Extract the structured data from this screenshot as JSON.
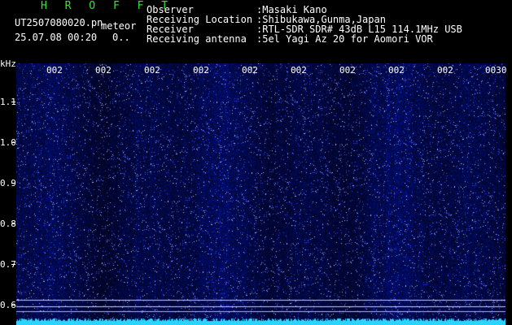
{
  "header": {
    "title": "H R O F F T",
    "file_name": "UT2507080020.pn",
    "file_tag": "meteor",
    "date_time": "25.07.08 00:20",
    "count": "0..",
    "rows": [
      {
        "label": "Observer",
        "value": ":Masaki Kano"
      },
      {
        "label": "Receiving Location",
        "value": ":Shibukawa,Gunma,Japan"
      },
      {
        "label": "Receiver",
        "value": ":RTL-SDR SDR# 43dB L15 114.1MHz USB"
      },
      {
        "label": "Receiving antenna",
        "value": ":5el Yagi Az 20 for Aomori VOR"
      }
    ]
  },
  "axis": {
    "unit": "kHz",
    "y_ticks": [
      "1.1",
      "1.0",
      "0.9",
      "0.8",
      "0.7",
      "0.6"
    ],
    "x_ticks": [
      "002",
      "002",
      "002",
      "002",
      "002",
      "002",
      "002",
      "002",
      "002",
      "0030"
    ]
  },
  "colors": {
    "background": "#000000",
    "spectrogram": "#10106a",
    "noise_floor": "#2ad4ff",
    "title": "#33e633"
  }
}
